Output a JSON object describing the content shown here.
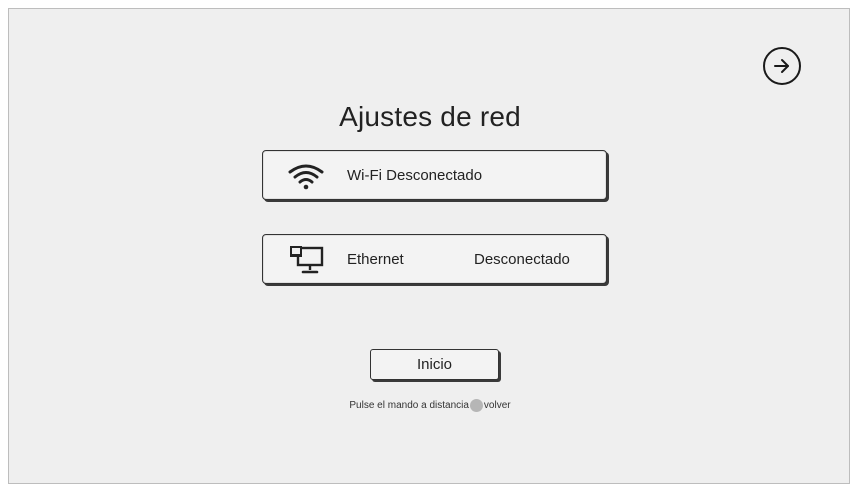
{
  "screen": {
    "title": "Ajustes de red",
    "next_icon": "arrow-right-circle-icon"
  },
  "wifi": {
    "icon": "wifi-icon",
    "label": "Wi-Fi Desconectado"
  },
  "ethernet": {
    "icon": "ethernet-monitor-icon",
    "label": "Ethernet",
    "status": "Desconectado"
  },
  "footer": {
    "home_label": "Inicio",
    "hint_before": "Pulse el mando a distancia",
    "hint_icon": "remote-back-button-icon",
    "hint_after": "volver"
  },
  "colors": {
    "background": "#efefef",
    "text": "#222222",
    "border": "#333333"
  }
}
